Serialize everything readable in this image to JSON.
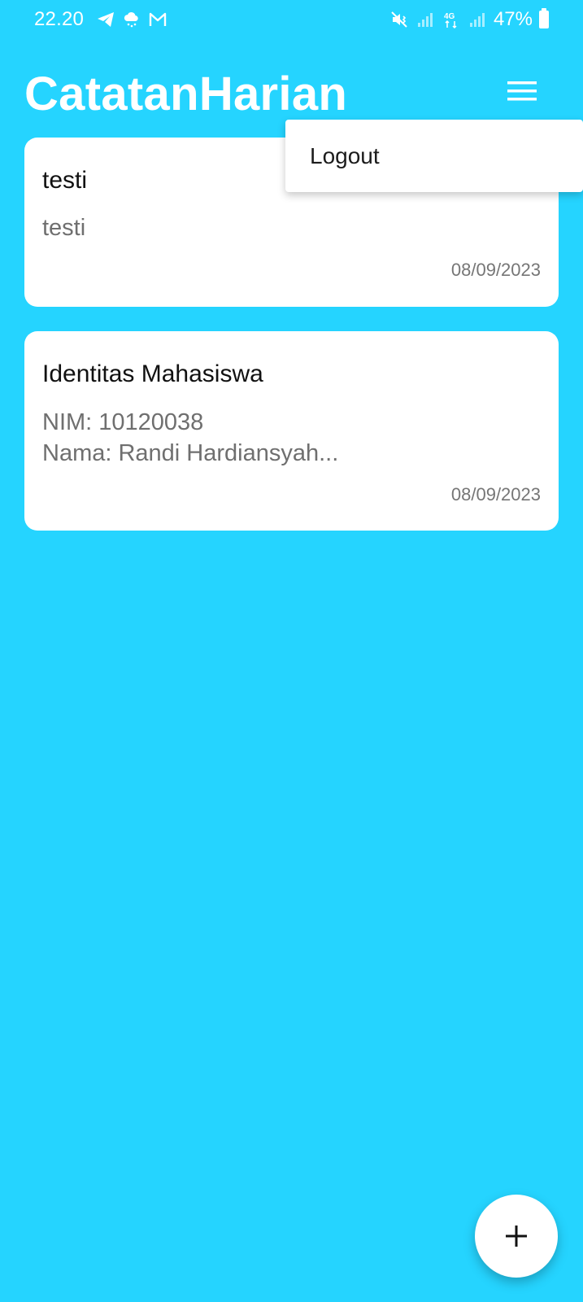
{
  "status_bar": {
    "time": "22.20",
    "left_icons": [
      "telegram-icon",
      "weather-icon",
      "gmail-icon"
    ],
    "right_icons": [
      "mute-vibrate-icon",
      "signal-icon",
      "4g-data-icon",
      "signal-icon",
      "battery-icon"
    ],
    "battery": "47%"
  },
  "header": {
    "title": "CatatanHarian",
    "menu_icon": "hamburger-menu-icon"
  },
  "notes": [
    {
      "title": "testi",
      "body": "testi",
      "date": "08/09/2023"
    },
    {
      "title": "Identitas Mahasiswa",
      "body": "NIM: 10120038\nNama: Randi Hardiansyah...",
      "date": "08/09/2023"
    }
  ],
  "popup_menu": {
    "items": [
      {
        "label": "Logout"
      }
    ]
  },
  "fab": {
    "icon": "plus-icon"
  },
  "colors": {
    "background": "#25d4ff",
    "card": "#ffffff",
    "title_text": "#ffffff",
    "note_title": "#111111",
    "note_body": "#6f6f6f"
  }
}
